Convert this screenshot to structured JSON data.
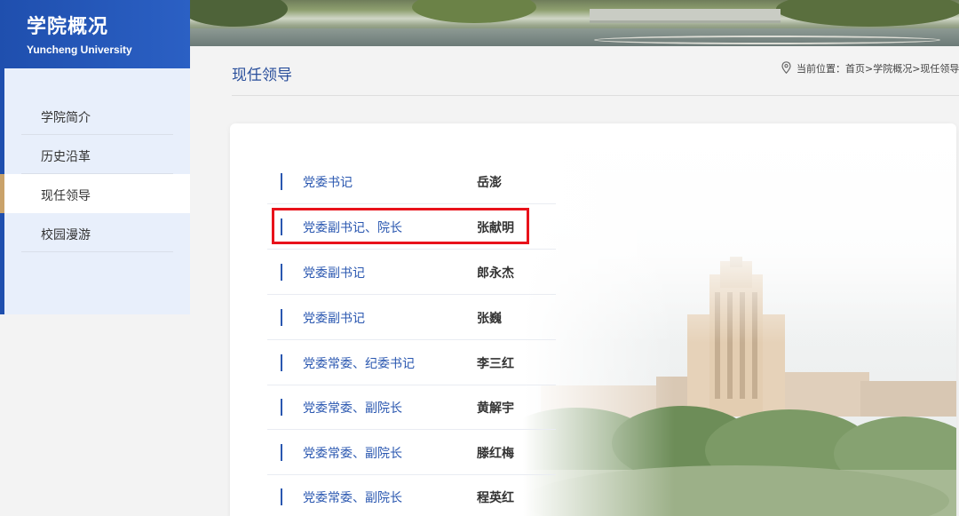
{
  "sidebar": {
    "title": "学院概况",
    "subtitle": "Yuncheng University",
    "items": [
      {
        "label": "学院简介",
        "active": false
      },
      {
        "label": "历史沿革",
        "active": false
      },
      {
        "label": "现任领导",
        "active": true
      },
      {
        "label": "校园漫游",
        "active": false
      }
    ]
  },
  "main": {
    "title": "现任领导",
    "breadcrumb": "当前位置：首页>学院概况>现任领导",
    "leaders": [
      {
        "role": "党委书记",
        "name": "岳澎"
      },
      {
        "role": "党委副书记、院长",
        "name": "张献明",
        "highlighted": true
      },
      {
        "role": "党委副书记",
        "name": "郎永杰"
      },
      {
        "role": "党委副书记",
        "name": "张巍"
      },
      {
        "role": "党委常委、纪委书记",
        "name": "李三红"
      },
      {
        "role": "党委常委、副院长",
        "name": "黄解宇"
      },
      {
        "role": "党委常委、副院长",
        "name": "滕红梅"
      },
      {
        "role": "党委常委、副院长",
        "name": "程英红"
      }
    ]
  },
  "colors": {
    "brand": "#1f4fae",
    "accent": "#c9a26a",
    "link": "#2a57b0",
    "highlight": "#e8121b"
  },
  "icons": {
    "breadcrumb": "location-pin-icon"
  }
}
